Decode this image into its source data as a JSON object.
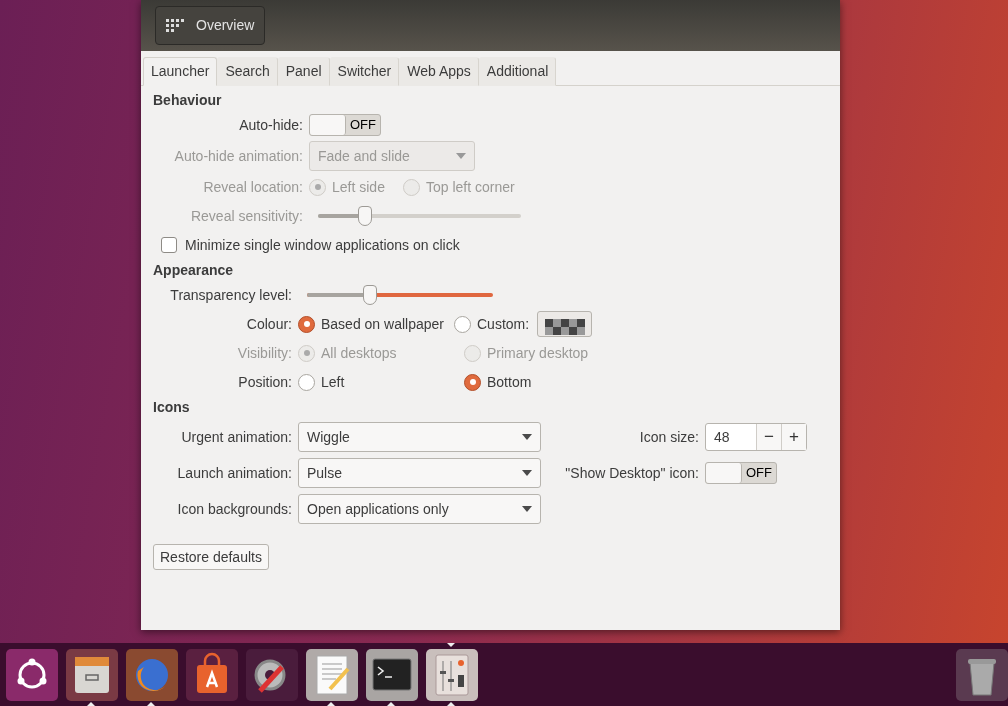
{
  "header": {
    "overview_button": "Overview"
  },
  "tabs": [
    {
      "label": "Launcher",
      "selected": true
    },
    {
      "label": "Search",
      "selected": false
    },
    {
      "label": "Panel",
      "selected": false
    },
    {
      "label": "Switcher",
      "selected": false
    },
    {
      "label": "Web Apps",
      "selected": false
    },
    {
      "label": "Additional",
      "selected": false
    }
  ],
  "sections": [
    {
      "title": "Behaviour",
      "rows": [
        {
          "kind": "switch",
          "label": "Auto-hide:",
          "on": false,
          "state_text": "OFF",
          "disabled": false
        },
        {
          "kind": "dropdown",
          "label": "Auto-hide animation:",
          "value": "Fade and slide",
          "disabled": true
        },
        {
          "kind": "radio",
          "label": "Reveal location:",
          "disabled": true,
          "options": [
            {
              "label": "Left side",
              "selected": true
            },
            {
              "label": "Top left corner",
              "selected": false
            }
          ]
        },
        {
          "kind": "slider",
          "label": "Reveal sensitivity:",
          "level": 0.25,
          "disabled": true
        },
        {
          "kind": "checkbox",
          "label": "Minimize single window applications on click",
          "checked": false,
          "disabled": false
        }
      ]
    },
    {
      "title": "Appearance",
      "rows": [
        {
          "kind": "slider",
          "label": "Transparency level:",
          "level": 0.35,
          "disabled": false
        },
        {
          "kind": "colour",
          "label": "Colour:",
          "disabled": false,
          "options": [
            {
              "label": "Based on wallpaper",
              "selected": true
            },
            {
              "label": "Custom:",
              "selected": false
            }
          ]
        },
        {
          "kind": "radio",
          "label": "Visibility:",
          "disabled": true,
          "options": [
            {
              "label": "All desktops",
              "selected": true
            },
            {
              "label": "Primary desktop",
              "selected": false
            }
          ]
        },
        {
          "kind": "radio",
          "label": "Position:",
          "disabled": false,
          "options": [
            {
              "label": "Left",
              "selected": false
            },
            {
              "label": "Bottom",
              "selected": true
            }
          ]
        }
      ]
    }
  ],
  "icons": {
    "title": "Icons",
    "left": [
      {
        "label": "Urgent animation:",
        "value": "Wiggle"
      },
      {
        "label": "Launch animation:",
        "value": "Pulse"
      },
      {
        "label": "Icon backgrounds:",
        "value": "Open applications only"
      }
    ],
    "right": [
      {
        "kind": "spin",
        "label": "Icon size:",
        "value": "48",
        "minus": "−",
        "plus": "+"
      },
      {
        "kind": "switch",
        "label": "\"Show Desktop\" icon:",
        "on": false,
        "state_text": "OFF"
      }
    ]
  },
  "restore_button": "Restore defaults",
  "dock": [
    {
      "kind": "ubuntu",
      "running": false,
      "focused": false
    },
    {
      "kind": "files",
      "running": true,
      "focused": false
    },
    {
      "kind": "browser",
      "running": true,
      "focused": false
    },
    {
      "kind": "store",
      "running": false,
      "focused": false
    },
    {
      "kind": "tools",
      "running": false,
      "focused": false
    },
    {
      "kind": "editor",
      "running": true,
      "focused": false
    },
    {
      "kind": "terminal",
      "running": true,
      "focused": false
    },
    {
      "kind": "tweak",
      "running": true,
      "focused": true
    },
    {
      "kind": "trash",
      "running": false,
      "focused": false
    }
  ]
}
